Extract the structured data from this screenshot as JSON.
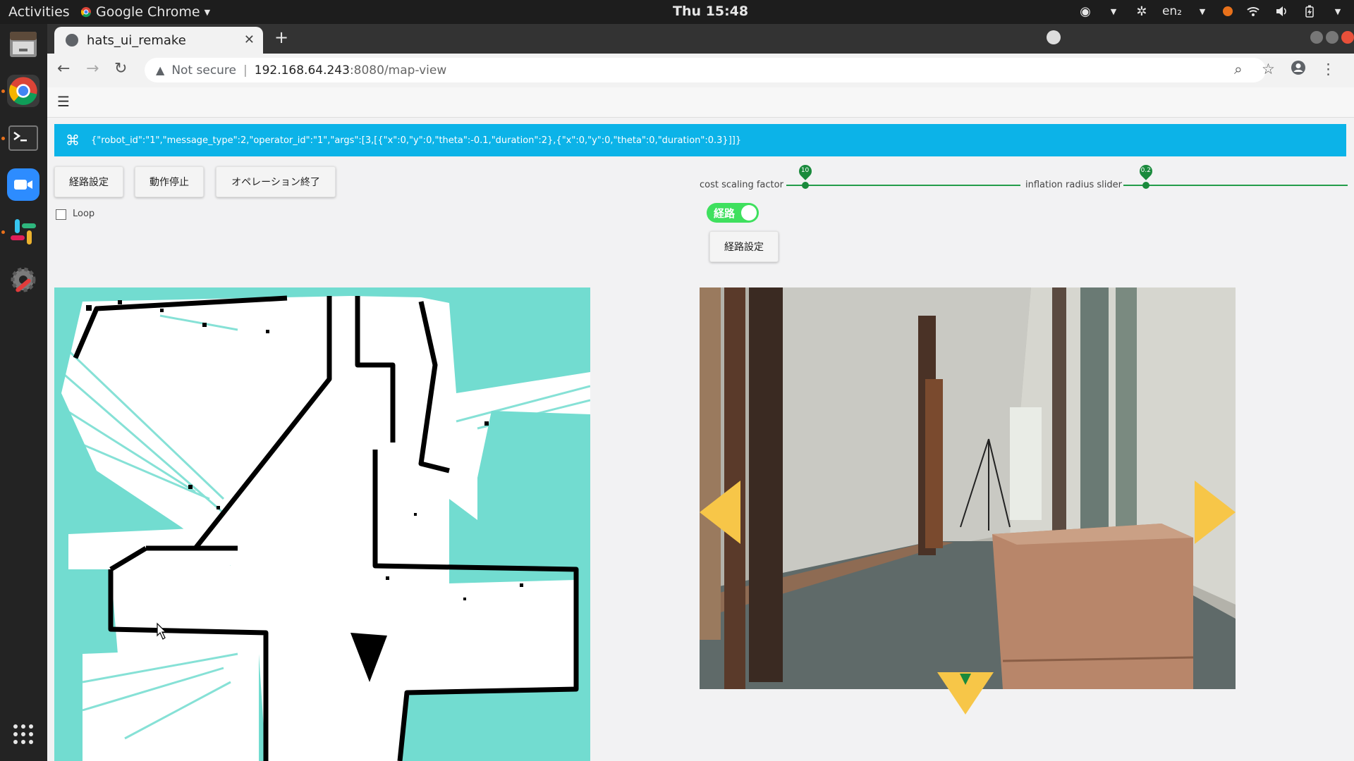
{
  "os": {
    "activities_label": "Activities",
    "app_menu_label": "Google Chrome",
    "clock": "Thu 15:48",
    "input_method": "en₂",
    "colors": {
      "topbar": "#1d1d1d",
      "dock": "#232323",
      "accent": "#e8711b"
    },
    "dock_icons": [
      "files-icon",
      "chrome-icon",
      "terminal-icon",
      "zoom-icon",
      "slack-icon",
      "settings-icon",
      "show-apps-icon"
    ]
  },
  "browser": {
    "tab_title": "hats_ui_remake",
    "url_warning": "Not secure",
    "url_host": "192.168.64.243",
    "url_path": ":8080/map-view"
  },
  "app": {
    "command_message": "{\"robot_id\":\"1\",\"message_type\":2,\"operator_id\":\"1\",\"args\":[3,[{\"x\":0,\"y\":0,\"theta\":-0.1,\"duration\":2},{\"x\":0,\"y\":0,\"theta\":0,\"duration\":0.3}]]}",
    "buttons": {
      "route_setting": "経路設定",
      "stop_motion": "動作停止",
      "end_operation": "オペレーション終了",
      "route_setting_right": "経路設定"
    },
    "loop_label": "Loop",
    "loop_checked": false,
    "cost_scaling": {
      "label": "cost scaling factor",
      "value": 10,
      "value_label": "10",
      "fraction": 0.08
    },
    "inflation_radius": {
      "label": "inflation radius slider",
      "value": 0.2,
      "value_label": "0.2",
      "fraction": 0.1
    },
    "route_toggle": {
      "label": "経路",
      "on": true
    },
    "colors": {
      "message_bar": "#0cb3e8",
      "slider": "#239d4a",
      "toggle": "#3fe05e",
      "map_unknown": "#72dcd0",
      "arrows": "#f7c648"
    }
  }
}
